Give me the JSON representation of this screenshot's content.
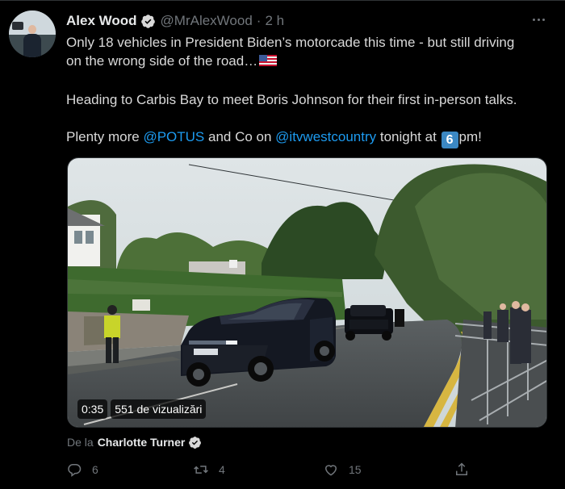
{
  "tweet": {
    "author_name": "Alex Wood",
    "author_handle": "@MrAlexWood",
    "separator": "·",
    "time": "2 h",
    "lines": {
      "line1": "Only 18 vehicles in President Biden’s motorcade this time - but still driving",
      "line2": "on the wrong side of the road…",
      "line3": "Heading to Carbis Bay to meet Boris Johnson for their first in-person talks.",
      "line4_prefix": "Plenty more ",
      "mention1": "@POTUS",
      "line4_mid": " and Co on ",
      "mention2": "@itvwestcountry",
      "line4_suffix": " tonight at ",
      "keycap": "6",
      "line4_end": "pm!"
    },
    "flag_icon": "us-flag-icon"
  },
  "video": {
    "duration": "0:35",
    "views": "551 de vizualizări"
  },
  "attribution": {
    "label": "De la",
    "name": "Charlotte Turner"
  },
  "actions": {
    "replies": "6",
    "retweets": "4",
    "likes": "15"
  },
  "colors": {
    "background": "#000000",
    "text": "#d9d9d9",
    "secondary": "#71767b",
    "link": "#1d9bf0",
    "verified": "#1d9bf0"
  }
}
